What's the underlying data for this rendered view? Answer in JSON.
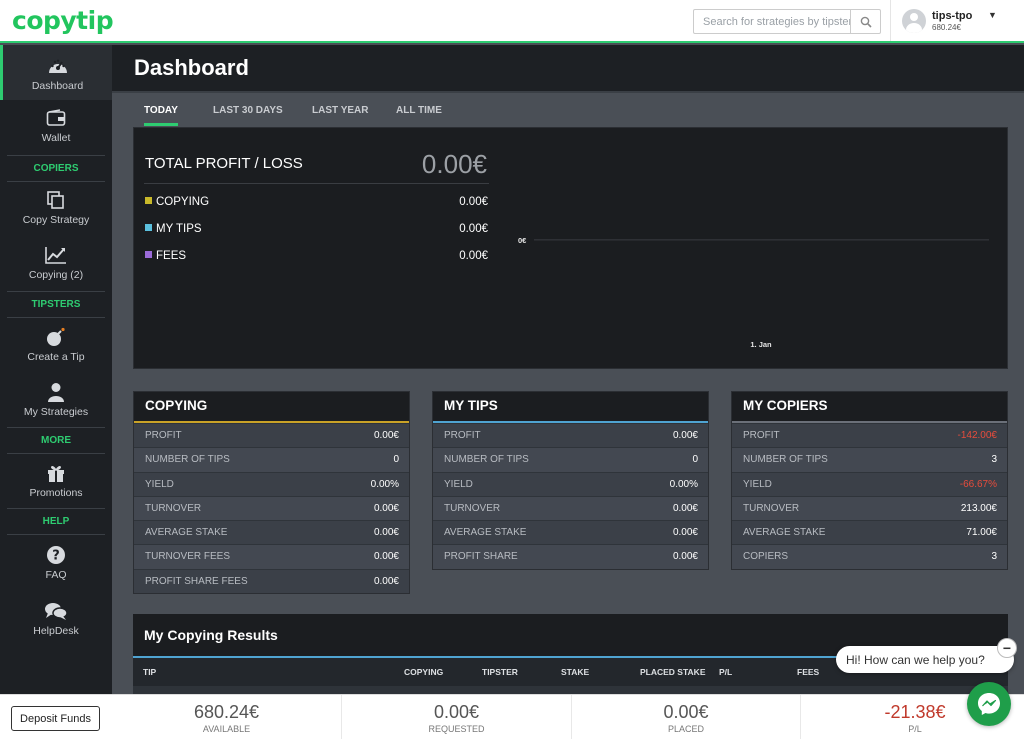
{
  "brand": {
    "logo": "copytip",
    "accent": "#2ecc71"
  },
  "header": {
    "search_placeholder": "Search for strategies by tipster",
    "username": "tips-tpo",
    "balance": "680.24€"
  },
  "sidebar": {
    "items": [
      {
        "label": "Dashboard",
        "icon": "dashboard-gauge-icon",
        "active": true
      },
      {
        "label": "Wallet",
        "icon": "wallet-icon"
      },
      {
        "label": "Copy Strategy",
        "icon": "copy-icon"
      },
      {
        "label": "Copying (2)",
        "icon": "line-chart-icon"
      },
      {
        "label": "Create a Tip",
        "icon": "bomb-icon"
      },
      {
        "label": "My Strategies",
        "icon": "user-icon"
      },
      {
        "label": "Promotions",
        "icon": "gift-icon"
      },
      {
        "label": "FAQ",
        "icon": "question-icon"
      },
      {
        "label": "HelpDesk",
        "icon": "chat-bubbles-icon"
      }
    ],
    "sections": [
      "COPIERS",
      "TIPSTERS",
      "MORE",
      "HELP"
    ]
  },
  "page": {
    "title": "Dashboard"
  },
  "tabs": [
    "TODAY",
    "LAST 30 DAYS",
    "LAST YEAR",
    "ALL TIME"
  ],
  "summary": {
    "title": "TOTAL PROFIT / LOSS",
    "total": "0.00€",
    "rows": [
      {
        "label": "COPYING",
        "value": "0.00€",
        "color": "#c9b92a"
      },
      {
        "label": "MY TIPS",
        "value": "0.00€",
        "color": "#5bc0de"
      },
      {
        "label": "FEES",
        "value": "0.00€",
        "color": "#9b6bd8"
      }
    ]
  },
  "chart_data": {
    "type": "line",
    "x": [
      "1. Jan"
    ],
    "series": [
      {
        "values": [
          0
        ]
      }
    ],
    "ytick_labels": [
      "0€"
    ],
    "xtick_labels": [
      "1. Jan"
    ],
    "grid": true
  },
  "cards": [
    {
      "title": "COPYING",
      "rows": [
        {
          "label": "PROFIT",
          "value": "0.00€"
        },
        {
          "label": "NUMBER OF TIPS",
          "value": "0"
        },
        {
          "label": "YIELD",
          "value": "0.00%"
        },
        {
          "label": "TURNOVER",
          "value": "0.00€"
        },
        {
          "label": "AVERAGE STAKE",
          "value": "0.00€"
        },
        {
          "label": "TURNOVER FEES",
          "value": "0.00€"
        },
        {
          "label": "PROFIT SHARE FEES",
          "value": "0.00€"
        }
      ]
    },
    {
      "title": "MY TIPS",
      "rows": [
        {
          "label": "PROFIT",
          "value": "0.00€"
        },
        {
          "label": "NUMBER OF TIPS",
          "value": "0"
        },
        {
          "label": "YIELD",
          "value": "0.00%"
        },
        {
          "label": "TURNOVER",
          "value": "0.00€"
        },
        {
          "label": "AVERAGE STAKE",
          "value": "0.00€"
        },
        {
          "label": "PROFIT SHARE",
          "value": "0.00€"
        }
      ]
    },
    {
      "title": "MY COPIERS",
      "rows": [
        {
          "label": "PROFIT",
          "value": "-142.00€"
        },
        {
          "label": "NUMBER OF TIPS",
          "value": "3"
        },
        {
          "label": "YIELD",
          "value": "-66.67%"
        },
        {
          "label": "TURNOVER",
          "value": "213.00€"
        },
        {
          "label": "AVERAGE STAKE",
          "value": "71.00€"
        },
        {
          "label": "COPIERS",
          "value": "3"
        }
      ]
    }
  ],
  "results": {
    "title": "My Copying Results",
    "columns": [
      "TIP",
      "COPYING",
      "TIPSTER",
      "STAKE",
      "PLACED STAKE",
      "P/L",
      "FEES"
    ]
  },
  "footer": {
    "deposit_label": "Deposit Funds",
    "stats": [
      {
        "value": "680.24€",
        "label": "AVAILABLE"
      },
      {
        "value": "0.00€",
        "label": "REQUESTED"
      },
      {
        "value": "0.00€",
        "label": "PLACED"
      },
      {
        "value": "-21.38€",
        "label": "P/L"
      }
    ]
  },
  "chat": {
    "greeting": "Hi! How can we help you?",
    "close_label": "−"
  }
}
